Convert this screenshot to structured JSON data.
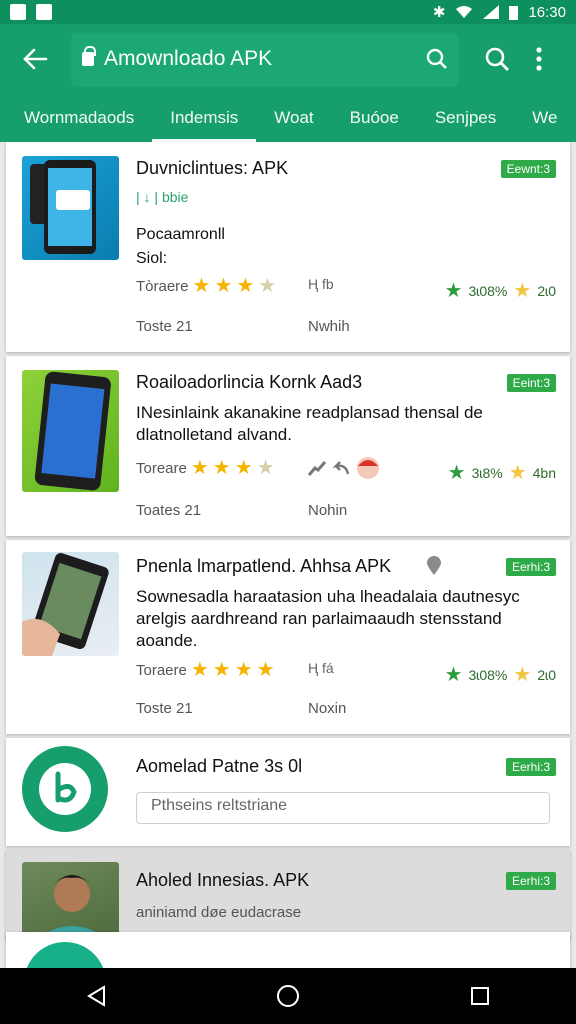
{
  "status": {
    "time": "16:30"
  },
  "search": {
    "text": "Amownloado APK"
  },
  "tabs": [
    "Wornmadaods",
    "Indemsis",
    "Woat",
    "Buóoe",
    "Senjpes",
    "We"
  ],
  "apps": [
    {
      "title": "Duvniclintues: APK",
      "badge": "Eewnt:3",
      "line1": "| ↓ |  bbie",
      "line2": "Pocaamronll",
      "line3": "Siol:",
      "rating_label": "Tòraere",
      "stars": 3.5,
      "mid": "Ⱨ fb",
      "rating_pct": "3ɩ08%",
      "rating_b": "2ɩ0",
      "date_label": "Toste 21",
      "date_mid": "Nwhih"
    },
    {
      "title": "Roailoadorlincia Kornk Aad3",
      "badge": "Eeint:3",
      "desc": "INesinlaink akanakine readplansad thensal de dlatnolletand alvand.",
      "rating_label": "Toreare",
      "stars": 3.5,
      "rating_pct": "3ɩ8%",
      "rating_b": "4bn",
      "date_label": "Toates 21",
      "date_mid": "Nohin"
    },
    {
      "title": "Pnenla lmarpatlend. Ahhsa APK",
      "badge": "Eerhi:3",
      "desc": "Sownesadla haraatasion uha lheadalaia dautnesyc arelgis aardhreand ran parlaimaaudh stensstand aoande.",
      "rating_label": "Toraere",
      "stars": 4,
      "mid": "Ⱨ fá",
      "rating_pct": "3ɩ08%",
      "rating_b": "2ɩ0",
      "date_label": "Toste 21",
      "date_mid": "Noxin"
    },
    {
      "title": "Aomelad Patne 3s 0l",
      "badge": "Eerhi:3",
      "reply_placeholder": "Pthseins reltstriane"
    },
    {
      "title": "Aholed Innesias. APK",
      "badge": "Eerhi:3",
      "sub": "aniniamd  døe eudacrase"
    }
  ],
  "colors": {
    "primary": "#169e6c",
    "badge": "#2eaa48",
    "star": "#f5b400"
  }
}
